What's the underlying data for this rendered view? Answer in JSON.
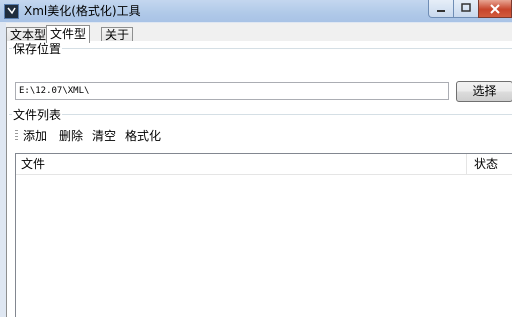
{
  "window": {
    "title": "Xml美化(格式化)工具",
    "icon": "app-icon"
  },
  "tabs": [
    {
      "label": "文本型",
      "active": false
    },
    {
      "label": "文件型",
      "active": true
    },
    {
      "label": "关于",
      "active": false
    }
  ],
  "save_location": {
    "group_label": "保存位置",
    "path_value": "E:\\12.07\\XML\\",
    "select_label": "选择"
  },
  "file_list": {
    "group_label": "文件列表",
    "toolbar": [
      "添加",
      "删除",
      "清空",
      "格式化"
    ],
    "columns": [
      "文件",
      "状态"
    ],
    "rows": []
  }
}
